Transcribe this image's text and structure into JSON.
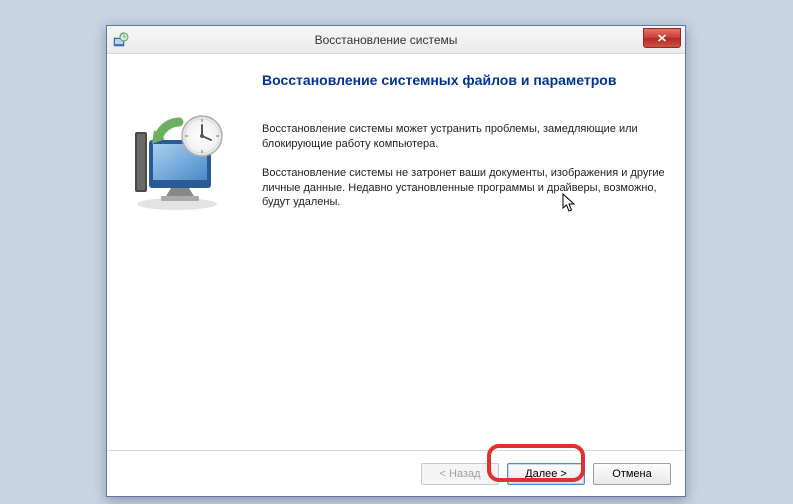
{
  "window": {
    "title": "Восстановление системы"
  },
  "content": {
    "heading": "Восстановление системных файлов и параметров",
    "paragraph1": "Восстановление системы может устранить проблемы, замедляющие или блокирующие работу компьютера.",
    "paragraph2": "Восстановление системы не затронет ваши документы, изображения и другие личные данные. Недавно установленные программы и драйверы, возможно, будут удалены."
  },
  "buttons": {
    "back": "< Назад",
    "next": "Далее >",
    "cancel": "Отмена"
  },
  "icons": {
    "close": "close-icon",
    "app": "restore-app-icon"
  }
}
